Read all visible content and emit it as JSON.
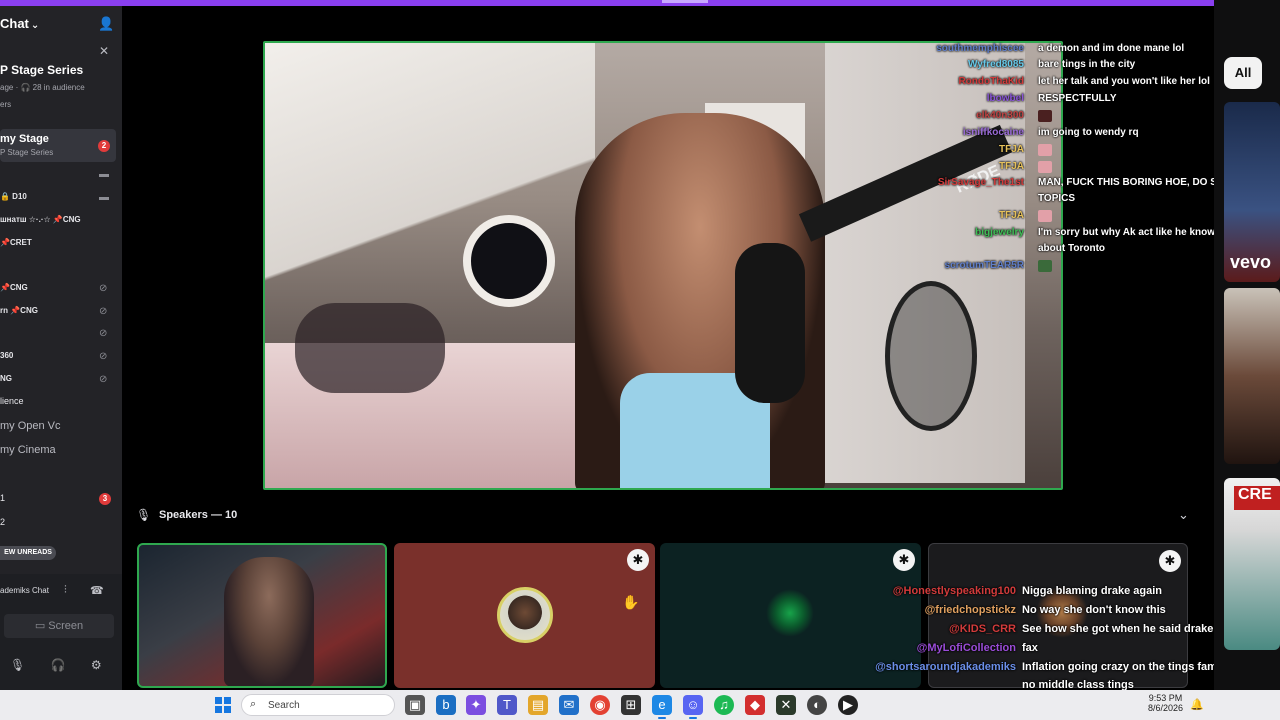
{
  "sidebar": {
    "header": "Chat",
    "series_title": "P Stage Series",
    "meta": "age · 🎧 28 in audience",
    "meta2": "ers",
    "stage_name": "my Stage",
    "stage_sub": "P Stage Series",
    "stage_badge": "2",
    "rows": [
      {
        "text": "🔒 D10",
        "bold": true
      },
      {
        "text": "шнатш ☆·.·☆ 📌CNG",
        "bold": true
      },
      {
        "text": "📌CRET",
        "bold": true
      },
      {
        "text": "📌CNG",
        "bold": true
      },
      {
        "text": "rn 📌CNG",
        "bold": true
      },
      {
        "text": "360",
        "bold": true
      },
      {
        "text": "NG",
        "bold": true
      }
    ],
    "audience_label": "lience",
    "channels": [
      "my Open Vc",
      "my Cinema"
    ],
    "row_1": "1",
    "row_1_badge": "3",
    "row_2": "2",
    "new_unreads": "EW UNREADS",
    "footer_title": "ademiks Chat",
    "screen_label": "Screen"
  },
  "chat_overlay": [
    {
      "user": "southmemphiscee",
      "msg": "a demon and im done mane lol",
      "color": "#5f7ec9"
    },
    {
      "user": "Wyfred8085",
      "msg": "bare tings in the city",
      "color": "#66c9e8"
    },
    {
      "user": "RondoThaKid",
      "msg": "let her talk and you won't like her lol",
      "color": "#d23b3b"
    },
    {
      "user": "lbowbel",
      "msg": "RESPECTFULLY",
      "color": "#8a55d8"
    },
    {
      "user": "elk40n300",
      "msg": "",
      "color": "#c04343",
      "emote": "#4a2020"
    },
    {
      "user": "isniffkocaine",
      "msg": "im going to wendy rq",
      "color": "#9a6bd8"
    },
    {
      "user": "TFJA",
      "msg": "",
      "color": "#e6c15a",
      "emote": "#e2a0a8"
    },
    {
      "user": "TFJA",
      "msg": "",
      "color": "#e6c15a",
      "emote": "#e2a0a8"
    },
    {
      "user": "SirSavage_The1st",
      "msg": "MAN, FUCK THIS BORING HOE, DO SOME",
      "color": "#d23b3b"
    },
    {
      "user": "",
      "msg": "TOPICS",
      "color": "#ffffff"
    },
    {
      "user": "TFJA",
      "msg": "",
      "color": "#e6c15a",
      "emote": "#e2a0a8"
    },
    {
      "user": "bigjewelry",
      "msg": "I'm sorry but why Ak act like he know so much",
      "color": "#3fbf56"
    },
    {
      "user": "",
      "msg": "about Toronto",
      "color": "#ffffff"
    },
    {
      "user": "scrotumTEAR5R",
      "msg": "",
      "color": "#5f7ec9",
      "emote": "#3a6a3a"
    }
  ],
  "speakers": {
    "title": "Speakers — 10",
    "chat_overlay": [
      {
        "user": "@Honestlyspeaking100",
        "msg": "Nigga blaming drake again",
        "color": "#d23b3b"
      },
      {
        "user": "@friedchopstickz",
        "msg": "No way she don't know this",
        "color": "#e0a060"
      },
      {
        "user": "@KIDS_CRR",
        "msg": "See how she got when he said drake lo",
        "color": "#d23b3b"
      },
      {
        "user": "@MyLofiCollection",
        "msg": "fax",
        "color": "#9a4cd8"
      },
      {
        "user": "@shortsaroundjakademiks",
        "msg": "Inflation going crazy on the tings fam their is",
        "color": "#6a8ee8"
      },
      {
        "user": "",
        "msg": "no middle class tings",
        "color": "#ffffff"
      }
    ]
  },
  "right_panel": {
    "filter_label": "All",
    "vevo": "vevo",
    "cre": "CRE"
  },
  "taskbar": {
    "search_placeholder": "Search",
    "time": "9:53 PM",
    "date": "8/6/2026"
  }
}
